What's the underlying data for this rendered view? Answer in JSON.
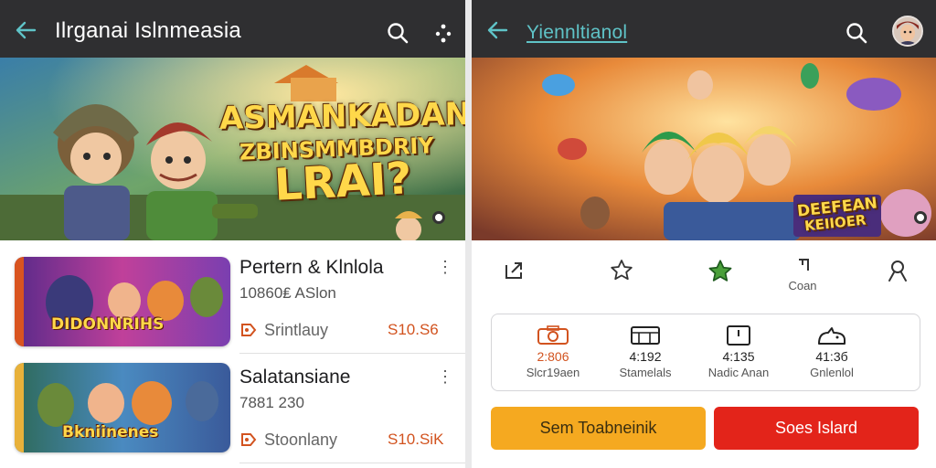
{
  "left_panel": {
    "appbar": {
      "title": "Ilrganai Islnmeasia"
    },
    "banner": {
      "line1": "ASMANKADANES",
      "line2": "ZBINSMMBDRIY",
      "line3": "LRAI?"
    },
    "items": [
      {
        "thumb_text": "DIDONNRIHS",
        "name": "Pertern & Klnlola",
        "sub": "10860₤ ASlon",
        "tag": "Srintlauy",
        "price": "S10.S6"
      },
      {
        "thumb_text": "Bkniinenes",
        "name": "Salatansiane",
        "sub": "7881 230",
        "tag": "Stoonlany",
        "price": "S10.SiK"
      }
    ]
  },
  "right_panel": {
    "appbar": {
      "title": "Yiennltianol"
    },
    "banner": {
      "badge_line1": "DEEFEAN",
      "badge_line2": "KEIIOER"
    },
    "actions": [
      {
        "icon": "share-icon",
        "label": ""
      },
      {
        "icon": "star-outline-icon",
        "label": ""
      },
      {
        "icon": "star-filled-icon",
        "label": ""
      },
      {
        "icon": "bookmark-icon",
        "label": "Coan"
      },
      {
        "icon": "user-icon",
        "label": ""
      }
    ],
    "stats": [
      {
        "icon": "camera-icon",
        "value": "2:806",
        "label": "Slcr19aen"
      },
      {
        "icon": "screen-icon",
        "value": "4:192",
        "label": "Stamelals"
      },
      {
        "icon": "timer-icon",
        "value": "4:135",
        "label": "Nadic Anan"
      },
      {
        "icon": "cat-icon",
        "value": "41:3б",
        "label": "Gnlenlol"
      }
    ],
    "buttons": {
      "primary": "Sem Toabneinik",
      "secondary": "Soes Islard"
    }
  },
  "colors": {
    "appbar": "#2f2f31",
    "teal": "#5fc3c7",
    "orange": "#f5a920",
    "red": "#e3241a",
    "price": "#d2531f"
  }
}
